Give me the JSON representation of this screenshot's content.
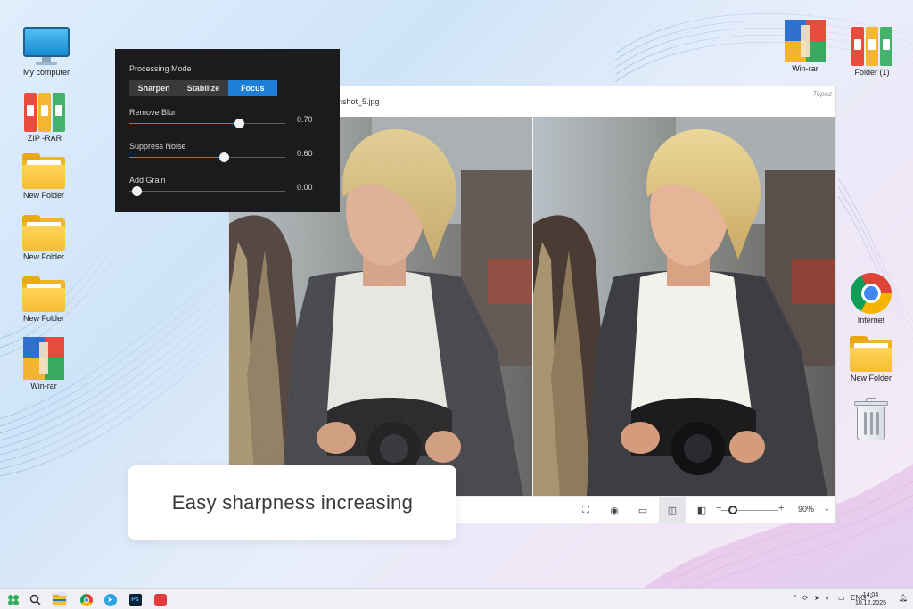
{
  "desktop": {
    "left_icons": [
      {
        "label": "My computer",
        "icon": "computer-icon"
      },
      {
        "label": "ZIP -RAR",
        "icon": "binders-icon"
      },
      {
        "label": "New Folder",
        "icon": "folder-icon"
      },
      {
        "label": "New Folder",
        "icon": "folder-icon"
      },
      {
        "label": "New Folder",
        "icon": "folder-icon"
      },
      {
        "label": "Win-rar",
        "icon": "winrar-icon"
      }
    ],
    "right_icons": [
      {
        "label": "Win-rar",
        "icon": "winrar-icon"
      },
      {
        "label": "Folder (1)",
        "icon": "binders-icon"
      },
      {
        "label": "Internet",
        "icon": "chrome-icon"
      },
      {
        "label": "New Folder",
        "icon": "folder-icon"
      },
      {
        "label": "",
        "icon": "trash-icon"
      }
    ]
  },
  "app": {
    "filename": "eenshot_5.jpg",
    "brand": "Topaz",
    "toolbar": {
      "zoom": "90%",
      "zoom_slider_fraction": 0.2,
      "buttons": [
        "fit-icon",
        "preview-eye-icon",
        "single-view-icon",
        "split-view-icon",
        "compare-icon"
      ],
      "active_button": "split-view-icon"
    }
  },
  "panel": {
    "title": "Processing Mode",
    "modes": [
      "Sharpen",
      "Stabilize",
      "Focus"
    ],
    "active_mode": "Focus",
    "sliders": [
      {
        "label": "Remove Blur",
        "value": "0.70",
        "fraction": 0.7
      },
      {
        "label": "Suppress Noise",
        "value": "0.60",
        "fraction": 0.6
      },
      {
        "label": "Add Grain",
        "value": "0.00",
        "fraction": 0.0
      }
    ]
  },
  "caption": "Easy sharpness increasing",
  "taskbar": {
    "language": "ENG",
    "time": "14:04",
    "date": "10.12.2025"
  },
  "colors": {
    "accent": "#1e7fd8",
    "panel_bg": "#1b1b1d"
  }
}
